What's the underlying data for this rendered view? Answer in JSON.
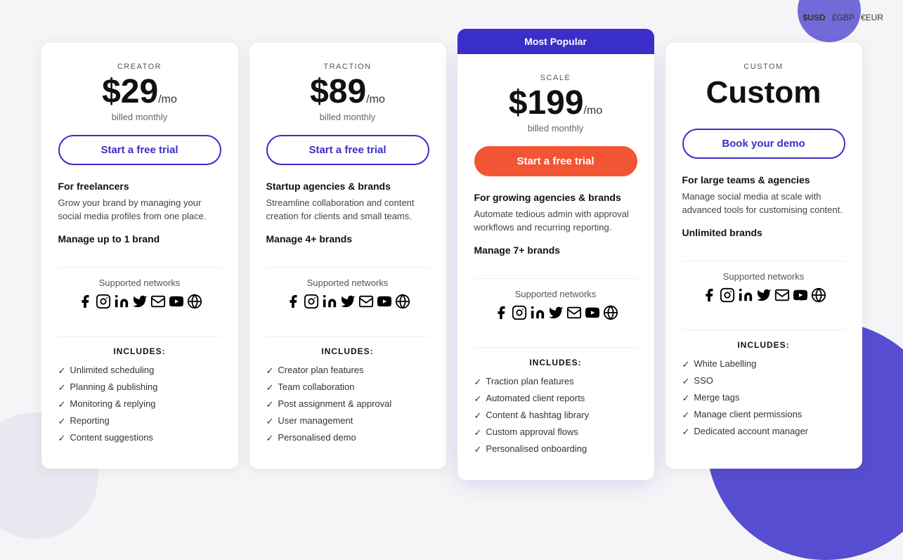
{
  "currency_bar": {
    "options": [
      "$USD",
      "£GBP",
      "€EUR"
    ],
    "active": "$USD"
  },
  "plans": [
    {
      "id": "creator",
      "label": "CREATOR",
      "price": "$29",
      "per_mo": "/mo",
      "billed": "billed monthly",
      "cta": "Start a free trial",
      "cta_type": "outline",
      "desc_title": "For freelancers",
      "desc_body": "Grow your brand by managing your social media profiles from one place.",
      "brands": "Manage up to 1 brand",
      "supported_label": "Supported networks",
      "networks": [
        "fb",
        "ig",
        "li",
        "tw",
        "gm",
        "yt",
        "wp"
      ],
      "includes_label": "INCLUDES:",
      "features": [
        "Unlimited scheduling",
        "Planning & publishing",
        "Monitoring & replying",
        "Reporting",
        "Content suggestions"
      ],
      "popular": false
    },
    {
      "id": "traction",
      "label": "TRACTION",
      "price": "$89",
      "per_mo": "/mo",
      "billed": "billed monthly",
      "cta": "Start a free trial",
      "cta_type": "outline",
      "desc_title": "Startup agencies & brands",
      "desc_body": "Streamline collaboration and content creation for clients and small teams.",
      "brands": "Manage 4+ brands",
      "supported_label": "Supported networks",
      "networks": [
        "fb",
        "ig",
        "li",
        "tw",
        "gm",
        "yt",
        "wp"
      ],
      "includes_label": "INCLUDES:",
      "features": [
        "Creator plan features",
        "Team collaboration",
        "Post assignment & approval",
        "User management",
        "Personalised demo"
      ],
      "popular": false
    },
    {
      "id": "scale",
      "label": "SCALE",
      "price": "$199",
      "per_mo": "/mo",
      "billed": "billed monthly",
      "cta": "Start a free trial",
      "cta_type": "orange",
      "desc_title": "For growing agencies & brands",
      "desc_body": "Automate tedious admin with approval workflows and recurring reporting.",
      "brands": "Manage 7+ brands",
      "supported_label": "Supported networks",
      "networks": [
        "fb",
        "ig",
        "li",
        "tw",
        "gm",
        "yt",
        "wp"
      ],
      "includes_label": "INCLUDES:",
      "features": [
        "Traction plan features",
        "Automated client reports",
        "Content & hashtag library",
        "Custom approval flows",
        "Personalised onboarding"
      ],
      "popular": true,
      "popular_badge": "Most Popular"
    },
    {
      "id": "custom",
      "label": "CUSTOM",
      "price": "Custom",
      "per_mo": "",
      "billed": "",
      "cta": "Book your demo",
      "cta_type": "outline",
      "desc_title": "For large teams & agencies",
      "desc_body": "Manage social media at scale with advanced tools for customising content.",
      "brands": "Unlimited brands",
      "supported_label": "Supported networks",
      "networks": [
        "fb",
        "ig",
        "li",
        "tw",
        "gm",
        "yt",
        "wp"
      ],
      "includes_label": "INCLUDES:",
      "features": [
        "White Labelling",
        "SSO",
        "Merge tags",
        "Manage client permissions",
        "Dedicated account manager"
      ],
      "popular": false
    }
  ]
}
